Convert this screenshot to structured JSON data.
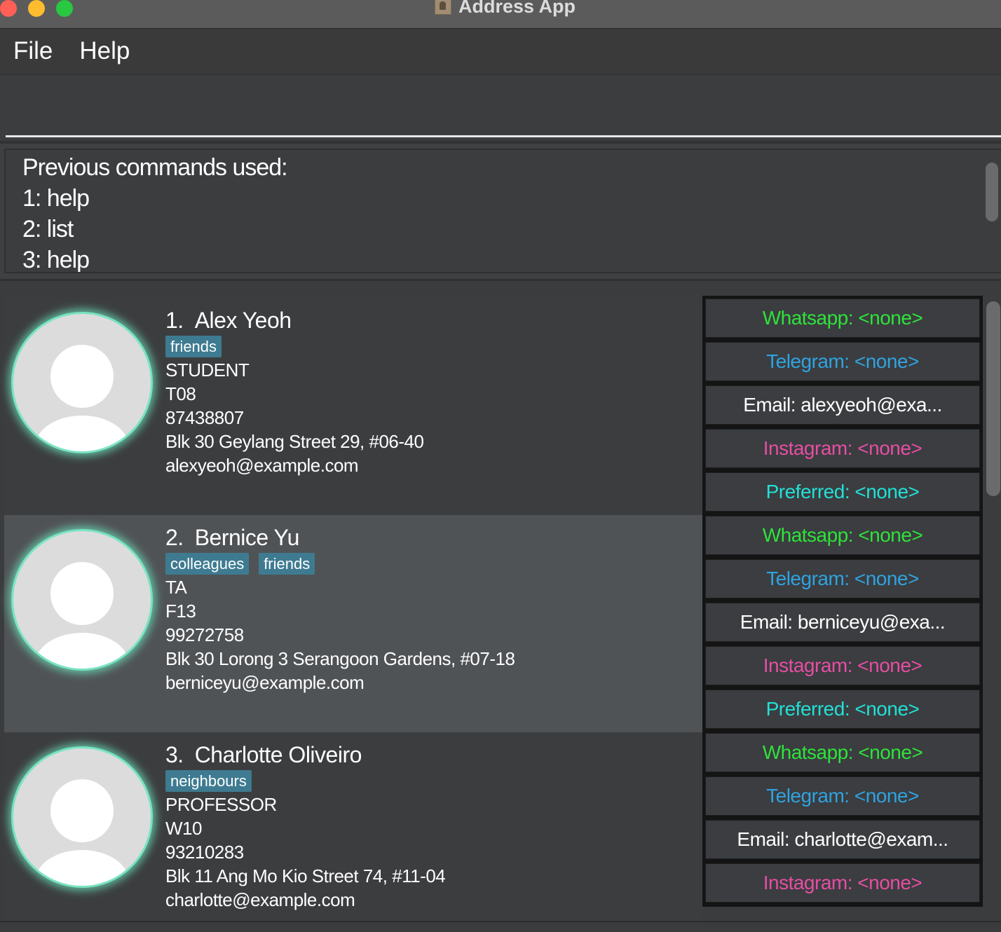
{
  "window": {
    "title": "Address App"
  },
  "menu": {
    "file": "File",
    "help": "Help"
  },
  "command": {
    "value": "",
    "placeholder": ""
  },
  "result": {
    "lines": [
      "Previous commands used:",
      "1: help",
      "2: list",
      "3: help"
    ]
  },
  "colors": {
    "whatsapp": "#2ee33a",
    "telegram": "#2fa3e0",
    "email": "#ffffff",
    "instagram": "#e64ea3",
    "preferred": "#22e0d6",
    "tag_bg": "#3e7b91",
    "avatar_glow": "#79e3c2"
  },
  "persons": [
    {
      "index": "1.",
      "name": "Alex Yeoh",
      "tags": [
        "friends"
      ],
      "role": "STUDENT",
      "tutorial": "T08",
      "phone": "87438807",
      "address": "Blk 30 Geylang Street 29, #06-40",
      "email": "alexyeoh@example.com",
      "contacts": {
        "whatsapp": "Whatsapp: <none>",
        "telegram": "Telegram: <none>",
        "email": "Email: alexyeoh@exa...",
        "instagram": "Instagram: <none>",
        "preferred": "Preferred: <none>"
      }
    },
    {
      "index": "2.",
      "name": "Bernice Yu",
      "tags": [
        "colleagues",
        "friends"
      ],
      "role": "TA",
      "tutorial": "F13",
      "phone": "99272758",
      "address": "Blk 30 Lorong 3 Serangoon Gardens, #07-18",
      "email": "berniceyu@example.com",
      "contacts": {
        "whatsapp": "Whatsapp: <none>",
        "telegram": "Telegram: <none>",
        "email": "Email: berniceyu@exa...",
        "instagram": "Instagram: <none>",
        "preferred": "Preferred: <none>"
      }
    },
    {
      "index": "3.",
      "name": "Charlotte Oliveiro",
      "tags": [
        "neighbours"
      ],
      "role": "PROFESSOR",
      "tutorial": "W10",
      "phone": "93210283",
      "address": "Blk 11 Ang Mo Kio Street 74, #11-04",
      "email": "charlotte@example.com",
      "contacts": {
        "whatsapp": "Whatsapp: <none>",
        "telegram": "Telegram: <none>",
        "email": "Email: charlotte@exam...",
        "instagram": "Instagram: <none>"
      }
    }
  ]
}
